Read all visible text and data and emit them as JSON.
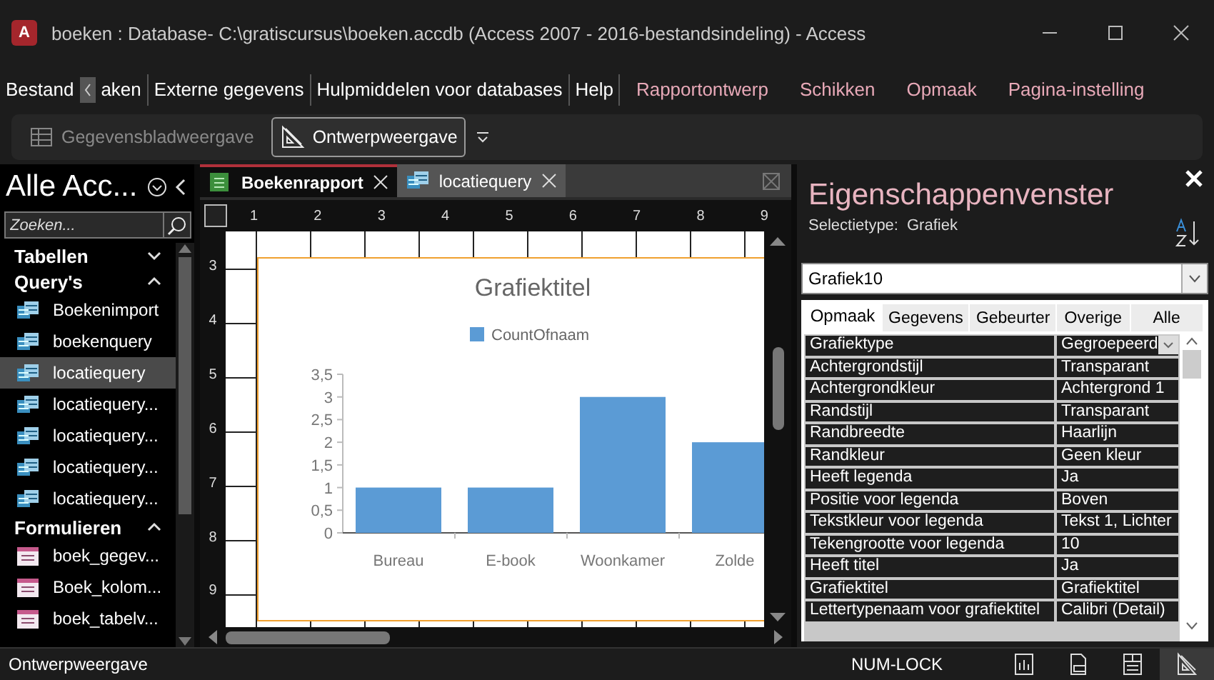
{
  "window": {
    "app_icon_letter": "A",
    "title": "boeken : Database- C:\\gratiscursus\\boeken.accdb (Access 2007 - 2016-bestandsindeling)  -  Access"
  },
  "ribbon": {
    "tabs": [
      {
        "label": "Bestand",
        "contextual": false
      },
      {
        "label": "aken",
        "contextual": false
      },
      {
        "label": "Externe gegevens",
        "contextual": false
      },
      {
        "label": "Hulpmiddelen voor databases",
        "contextual": false
      },
      {
        "label": "Help",
        "contextual": false
      },
      {
        "label": "Rapportontwerp",
        "contextual": true
      },
      {
        "label": "Schikken",
        "contextual": true
      },
      {
        "label": "Opmaak",
        "contextual": true
      },
      {
        "label": "Pagina-instelling",
        "contextual": true
      }
    ],
    "commands": [
      {
        "label": "Gegevensbladweergave",
        "kind": "datasheet",
        "disabled": true,
        "selected": false
      },
      {
        "label": "Ontwerpweergave",
        "kind": "design",
        "disabled": false,
        "selected": true
      }
    ]
  },
  "navigation": {
    "title": "Alle Acc...",
    "search": {
      "placeholder": "Zoeken..."
    },
    "groups": [
      {
        "label": "Tabellen",
        "expanded": false
      },
      {
        "label": "Query's",
        "expanded": true,
        "items": [
          {
            "label": "Boekenimport",
            "kind": "query",
            "selected": false
          },
          {
            "label": "boekenquery",
            "kind": "query",
            "selected": false
          },
          {
            "label": "locatiequery",
            "kind": "query",
            "selected": true
          },
          {
            "label": "locatiequery...",
            "kind": "query",
            "selected": false
          },
          {
            "label": "locatiequery...",
            "kind": "query",
            "selected": false
          },
          {
            "label": "locatiequery...",
            "kind": "query",
            "selected": false
          },
          {
            "label": "locatiequery...",
            "kind": "query",
            "selected": false
          }
        ]
      },
      {
        "label": "Formulieren",
        "expanded": true,
        "items": [
          {
            "label": "boek_gegev...",
            "kind": "form",
            "selected": false
          },
          {
            "label": "Boek_kolom...",
            "kind": "form",
            "selected": false
          },
          {
            "label": "boek_tabelv...",
            "kind": "form",
            "selected": false
          }
        ]
      }
    ]
  },
  "document": {
    "tabs": [
      {
        "label": "Boekenrapport",
        "kind": "report",
        "selected": true
      },
      {
        "label": "locatiequery",
        "kind": "query",
        "selected": false
      }
    ],
    "ruler": {
      "horizontal": [
        "1",
        "2",
        "3",
        "4",
        "5",
        "6",
        "7",
        "8",
        "9"
      ],
      "vertical": [
        "3",
        "4",
        "5",
        "6",
        "7",
        "8",
        "9"
      ]
    },
    "chart_data": {
      "type": "bar",
      "title": "Grafiektitel",
      "categories": [
        "Bureau",
        "E-book",
        "Woonkamer",
        "Zolde"
      ],
      "series": [
        {
          "name": "CountOfnaam",
          "color": "#5b9bd5",
          "values": [
            1,
            1,
            3,
            2
          ]
        }
      ],
      "ylim": [
        0,
        3.5
      ],
      "yticks": [
        {
          "value": 0,
          "label": "0"
        },
        {
          "value": 0.5,
          "label": "0,5"
        },
        {
          "value": 1,
          "label": "1"
        },
        {
          "value": 1.5,
          "label": "1,5"
        },
        {
          "value": 2,
          "label": "2"
        },
        {
          "value": 2.5,
          "label": "2,5"
        },
        {
          "value": 3,
          "label": "3"
        },
        {
          "value": 3.5,
          "label": "3,5"
        }
      ]
    }
  },
  "property_sheet": {
    "title": "Eigenschappenvenster",
    "selection_label": "Selectietype:",
    "selection_type": "Grafiek",
    "object": "Grafiek10",
    "tabs": [
      {
        "label": "Opmaak",
        "selected": true
      },
      {
        "label": "Gegevens",
        "selected": false
      },
      {
        "label": "Gebeurter",
        "selected": false
      },
      {
        "label": "Overige",
        "selected": false
      },
      {
        "label": "Alle",
        "selected": false
      }
    ],
    "properties": [
      {
        "name": "Grafiektype",
        "value": "Gegroepeerd",
        "kind": "dropdown"
      },
      {
        "name": "Achtergrondstijl",
        "value": "Transparant",
        "kind": "text"
      },
      {
        "name": "Achtergrondkleur",
        "value": "Achtergrond 1",
        "kind": "text"
      },
      {
        "name": "Randstijl",
        "value": "Transparant",
        "kind": "text"
      },
      {
        "name": "Randbreedte",
        "value": "Haarlijn",
        "kind": "text"
      },
      {
        "name": "Randkleur",
        "value": "Geen kleur",
        "kind": "text"
      },
      {
        "name": "Heeft legenda",
        "value": "Ja",
        "kind": "text"
      },
      {
        "name": "Positie voor legenda",
        "value": "Boven",
        "kind": "text"
      },
      {
        "name": "Tekstkleur voor legenda",
        "value": "Tekst 1, Lichter",
        "kind": "text"
      },
      {
        "name": "Tekengrootte voor legenda",
        "value": "10",
        "kind": "text"
      },
      {
        "name": "Heeft titel",
        "value": "Ja",
        "kind": "text"
      },
      {
        "name": "Grafiektitel",
        "value": "Grafiektitel",
        "kind": "text"
      },
      {
        "name": "Lettertypenaam voor grafiektitel",
        "value": "Calibri (Detail)",
        "kind": "text"
      }
    ]
  },
  "status_bar": {
    "text": "Ontwerpweergave",
    "num_lock": "NUM-LOCK",
    "views": [
      {
        "kind": "report",
        "selected": false
      },
      {
        "kind": "print",
        "selected": false
      },
      {
        "kind": "layout",
        "selected": false
      },
      {
        "kind": "design",
        "selected": true
      }
    ]
  }
}
